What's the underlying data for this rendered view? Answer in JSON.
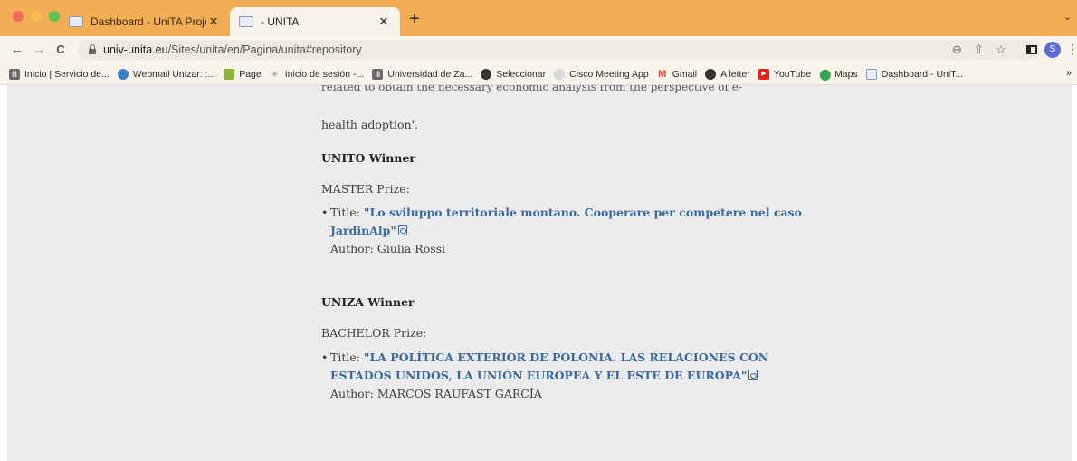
{
  "browser": {
    "tabs": [
      {
        "title": "Dashboard - UniTA Project Dat",
        "close": "✕"
      },
      {
        "title": "- UNITA",
        "close": "✕"
      }
    ],
    "new_tab": "+",
    "tab_menu": "⌄",
    "nav": {
      "back": "←",
      "forward": "→",
      "reload": "C"
    },
    "url_host": "univ-unita.eu",
    "url_path": "/Sites/unita/en/Pagina/unita#repository",
    "profile_initial": "S",
    "bookmarks": [
      {
        "label": "Inicio | Servicio de...",
        "icon": "university-icon",
        "color": "#6b6b6b"
      },
      {
        "label": "Webmail Unizar: :...",
        "icon": "webmail-icon",
        "color": "#3b82c4"
      },
      {
        "label": "Page",
        "icon": "page-icon",
        "color": "#8bb43a"
      },
      {
        "label": "Inicio de sesión -...",
        "icon": "star-login-icon",
        "color": "#a0a0a0"
      },
      {
        "label": "Universidad de Za...",
        "icon": "university-icon",
        "color": "#6b6b6b"
      },
      {
        "label": "Seleccionar",
        "icon": "globe-icon",
        "color": "#333333"
      },
      {
        "label": "Cisco Meeting App",
        "icon": "cisco-icon",
        "color": "#c9c9c9"
      },
      {
        "label": "Gmail",
        "icon": "gmail-icon",
        "color": "#d44638"
      },
      {
        "label": "A letter",
        "icon": "globe-icon",
        "color": "#333333"
      },
      {
        "label": "YouTube",
        "icon": "youtube-icon",
        "color": "#e62117"
      },
      {
        "label": "Maps",
        "icon": "maps-icon",
        "color": "#34a853"
      },
      {
        "label": "Dashboard - UniT...",
        "icon": "dashboard-icon",
        "color": "#8a9bb5"
      }
    ],
    "bookmarks_more": "»"
  },
  "page": {
    "cut_line": "related to obtain the necessary economic analysis from the perspective of e-",
    "para_end": "health adoption'.",
    "sections": [
      {
        "winner": "UNITO Winner",
        "prize": "MASTER Prize:",
        "title_prefix": "Title: ",
        "title_link": "\"Lo sviluppo territoriale montano. Cooperare per competere nel caso JardinAlp\"",
        "author": "Author: Giulia Rossi"
      },
      {
        "winner": "UNIZA Winner",
        "prize": "BACHELOR Prize:",
        "title_prefix": "Title: ",
        "title_link": "\"LA POLÍTICA EXTERIOR DE POLONIA. LAS RELACIONES CON ESTADOS UNIDOS, LA UNIÓN EUROPEA Y EL ESTE DE EUROPA\"",
        "author": "Author: MARCOS RAUFAST GARCÍA"
      }
    ]
  }
}
